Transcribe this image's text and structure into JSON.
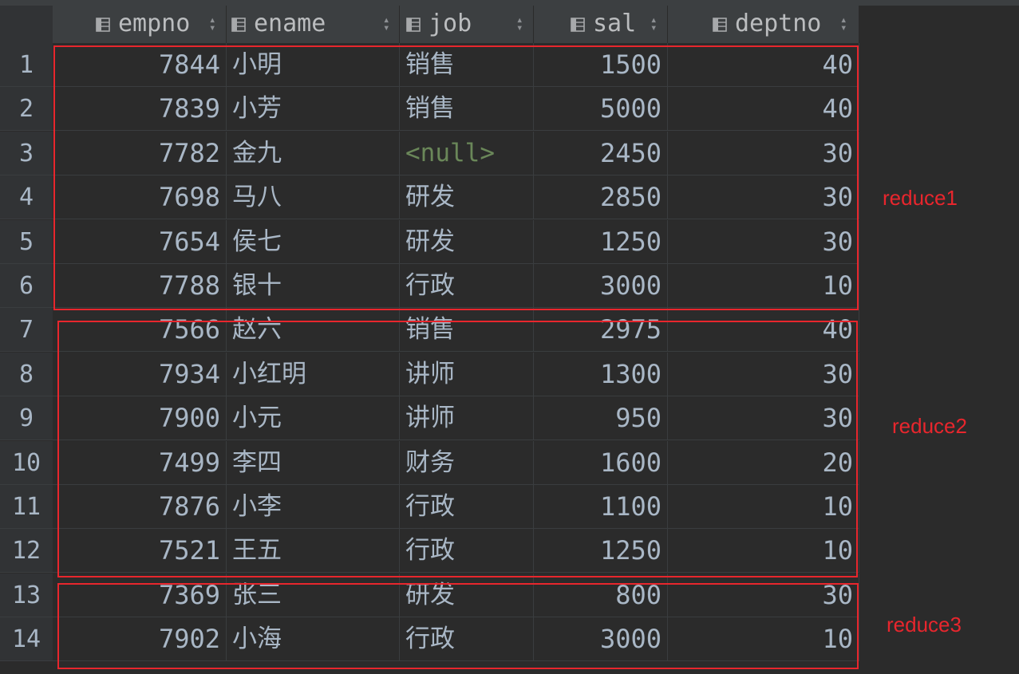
{
  "columns": [
    {
      "key": "empno",
      "label": "empno"
    },
    {
      "key": "ename",
      "label": "ename"
    },
    {
      "key": "job",
      "label": "job"
    },
    {
      "key": "sal",
      "label": "sal"
    },
    {
      "key": "deptno",
      "label": "deptno"
    }
  ],
  "icons": {
    "column_icon": "table-column-icon",
    "sort_icon": "sort-arrows-icon"
  },
  "rows": [
    {
      "n": "1",
      "empno": "7844",
      "ename": "小明",
      "job": "销售",
      "sal": "1500",
      "deptno": "40"
    },
    {
      "n": "2",
      "empno": "7839",
      "ename": "小芳",
      "job": "销售",
      "sal": "5000",
      "deptno": "40"
    },
    {
      "n": "3",
      "empno": "7782",
      "ename": "金九",
      "job": "<null>",
      "sal": "2450",
      "deptno": "30"
    },
    {
      "n": "4",
      "empno": "7698",
      "ename": "马八",
      "job": "研发",
      "sal": "2850",
      "deptno": "30"
    },
    {
      "n": "5",
      "empno": "7654",
      "ename": "侯七",
      "job": "研发",
      "sal": "1250",
      "deptno": "30"
    },
    {
      "n": "6",
      "empno": "7788",
      "ename": "银十",
      "job": "行政",
      "sal": "3000",
      "deptno": "10"
    },
    {
      "n": "7",
      "empno": "7566",
      "ename": "赵六",
      "job": "销售",
      "sal": "2975",
      "deptno": "40"
    },
    {
      "n": "8",
      "empno": "7934",
      "ename": "小红明",
      "job": "讲师",
      "sal": "1300",
      "deptno": "30"
    },
    {
      "n": "9",
      "empno": "7900",
      "ename": "小元",
      "job": "讲师",
      "sal": "950",
      "deptno": "30"
    },
    {
      "n": "10",
      "empno": "7499",
      "ename": "李四",
      "job": "财务",
      "sal": "1600",
      "deptno": "20"
    },
    {
      "n": "11",
      "empno": "7876",
      "ename": "小李",
      "job": "行政",
      "sal": "1100",
      "deptno": "10"
    },
    {
      "n": "12",
      "empno": "7521",
      "ename": "王五",
      "job": "行政",
      "sal": "1250",
      "deptno": "10"
    },
    {
      "n": "13",
      "empno": "7369",
      "ename": "张三",
      "job": "研发",
      "sal": "800",
      "deptno": "30"
    },
    {
      "n": "14",
      "empno": "7902",
      "ename": "小海",
      "job": "行政",
      "sal": "3000",
      "deptno": "10"
    }
  ],
  "annotations": [
    {
      "label": "reduce1",
      "color": "#e8262d"
    },
    {
      "label": "reduce2",
      "color": "#e8262d"
    },
    {
      "label": "reduce3",
      "color": "#e8262d"
    }
  ],
  "colors": {
    "background": "#2b2b2b",
    "header": "#3c3f41",
    "text": "#a9b7c6",
    "null_text": "#6a8759",
    "annotation": "#e8262d"
  }
}
